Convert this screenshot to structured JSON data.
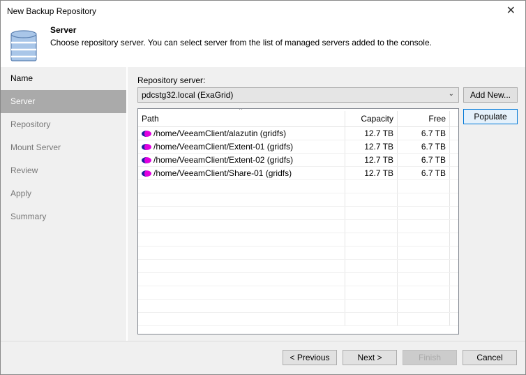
{
  "window": {
    "title": "New Backup Repository",
    "close": "✕"
  },
  "header": {
    "title": "Server",
    "description": "Choose repository server. You can select server from the list of managed servers added to the console."
  },
  "sidebar": {
    "items": [
      {
        "label": "Name"
      },
      {
        "label": "Server"
      },
      {
        "label": "Repository"
      },
      {
        "label": "Mount Server"
      },
      {
        "label": "Review"
      },
      {
        "label": "Apply"
      },
      {
        "label": "Summary"
      }
    ]
  },
  "main": {
    "server_label": "Repository server:",
    "server_value": "pdcstg32.local (ExaGrid)",
    "add_new": "Add New...",
    "populate": "Populate",
    "columns": [
      "Path",
      "Capacity",
      "Free"
    ],
    "rows": [
      {
        "path": "/home/VeeamClient/alazutin (gridfs)",
        "capacity": "12.7 TB",
        "free": "6.7 TB"
      },
      {
        "path": "/home/VeeamClient/Extent-01 (gridfs)",
        "capacity": "12.7 TB",
        "free": "6.7 TB"
      },
      {
        "path": "/home/VeeamClient/Extent-02 (gridfs)",
        "capacity": "12.7 TB",
        "free": "6.7 TB"
      },
      {
        "path": "/home/VeeamClient/Share-01 (gridfs)",
        "capacity": "12.7 TB",
        "free": "6.7 TB"
      }
    ]
  },
  "footer": {
    "previous": "< Previous",
    "next": "Next >",
    "finish": "Finish",
    "cancel": "Cancel"
  }
}
